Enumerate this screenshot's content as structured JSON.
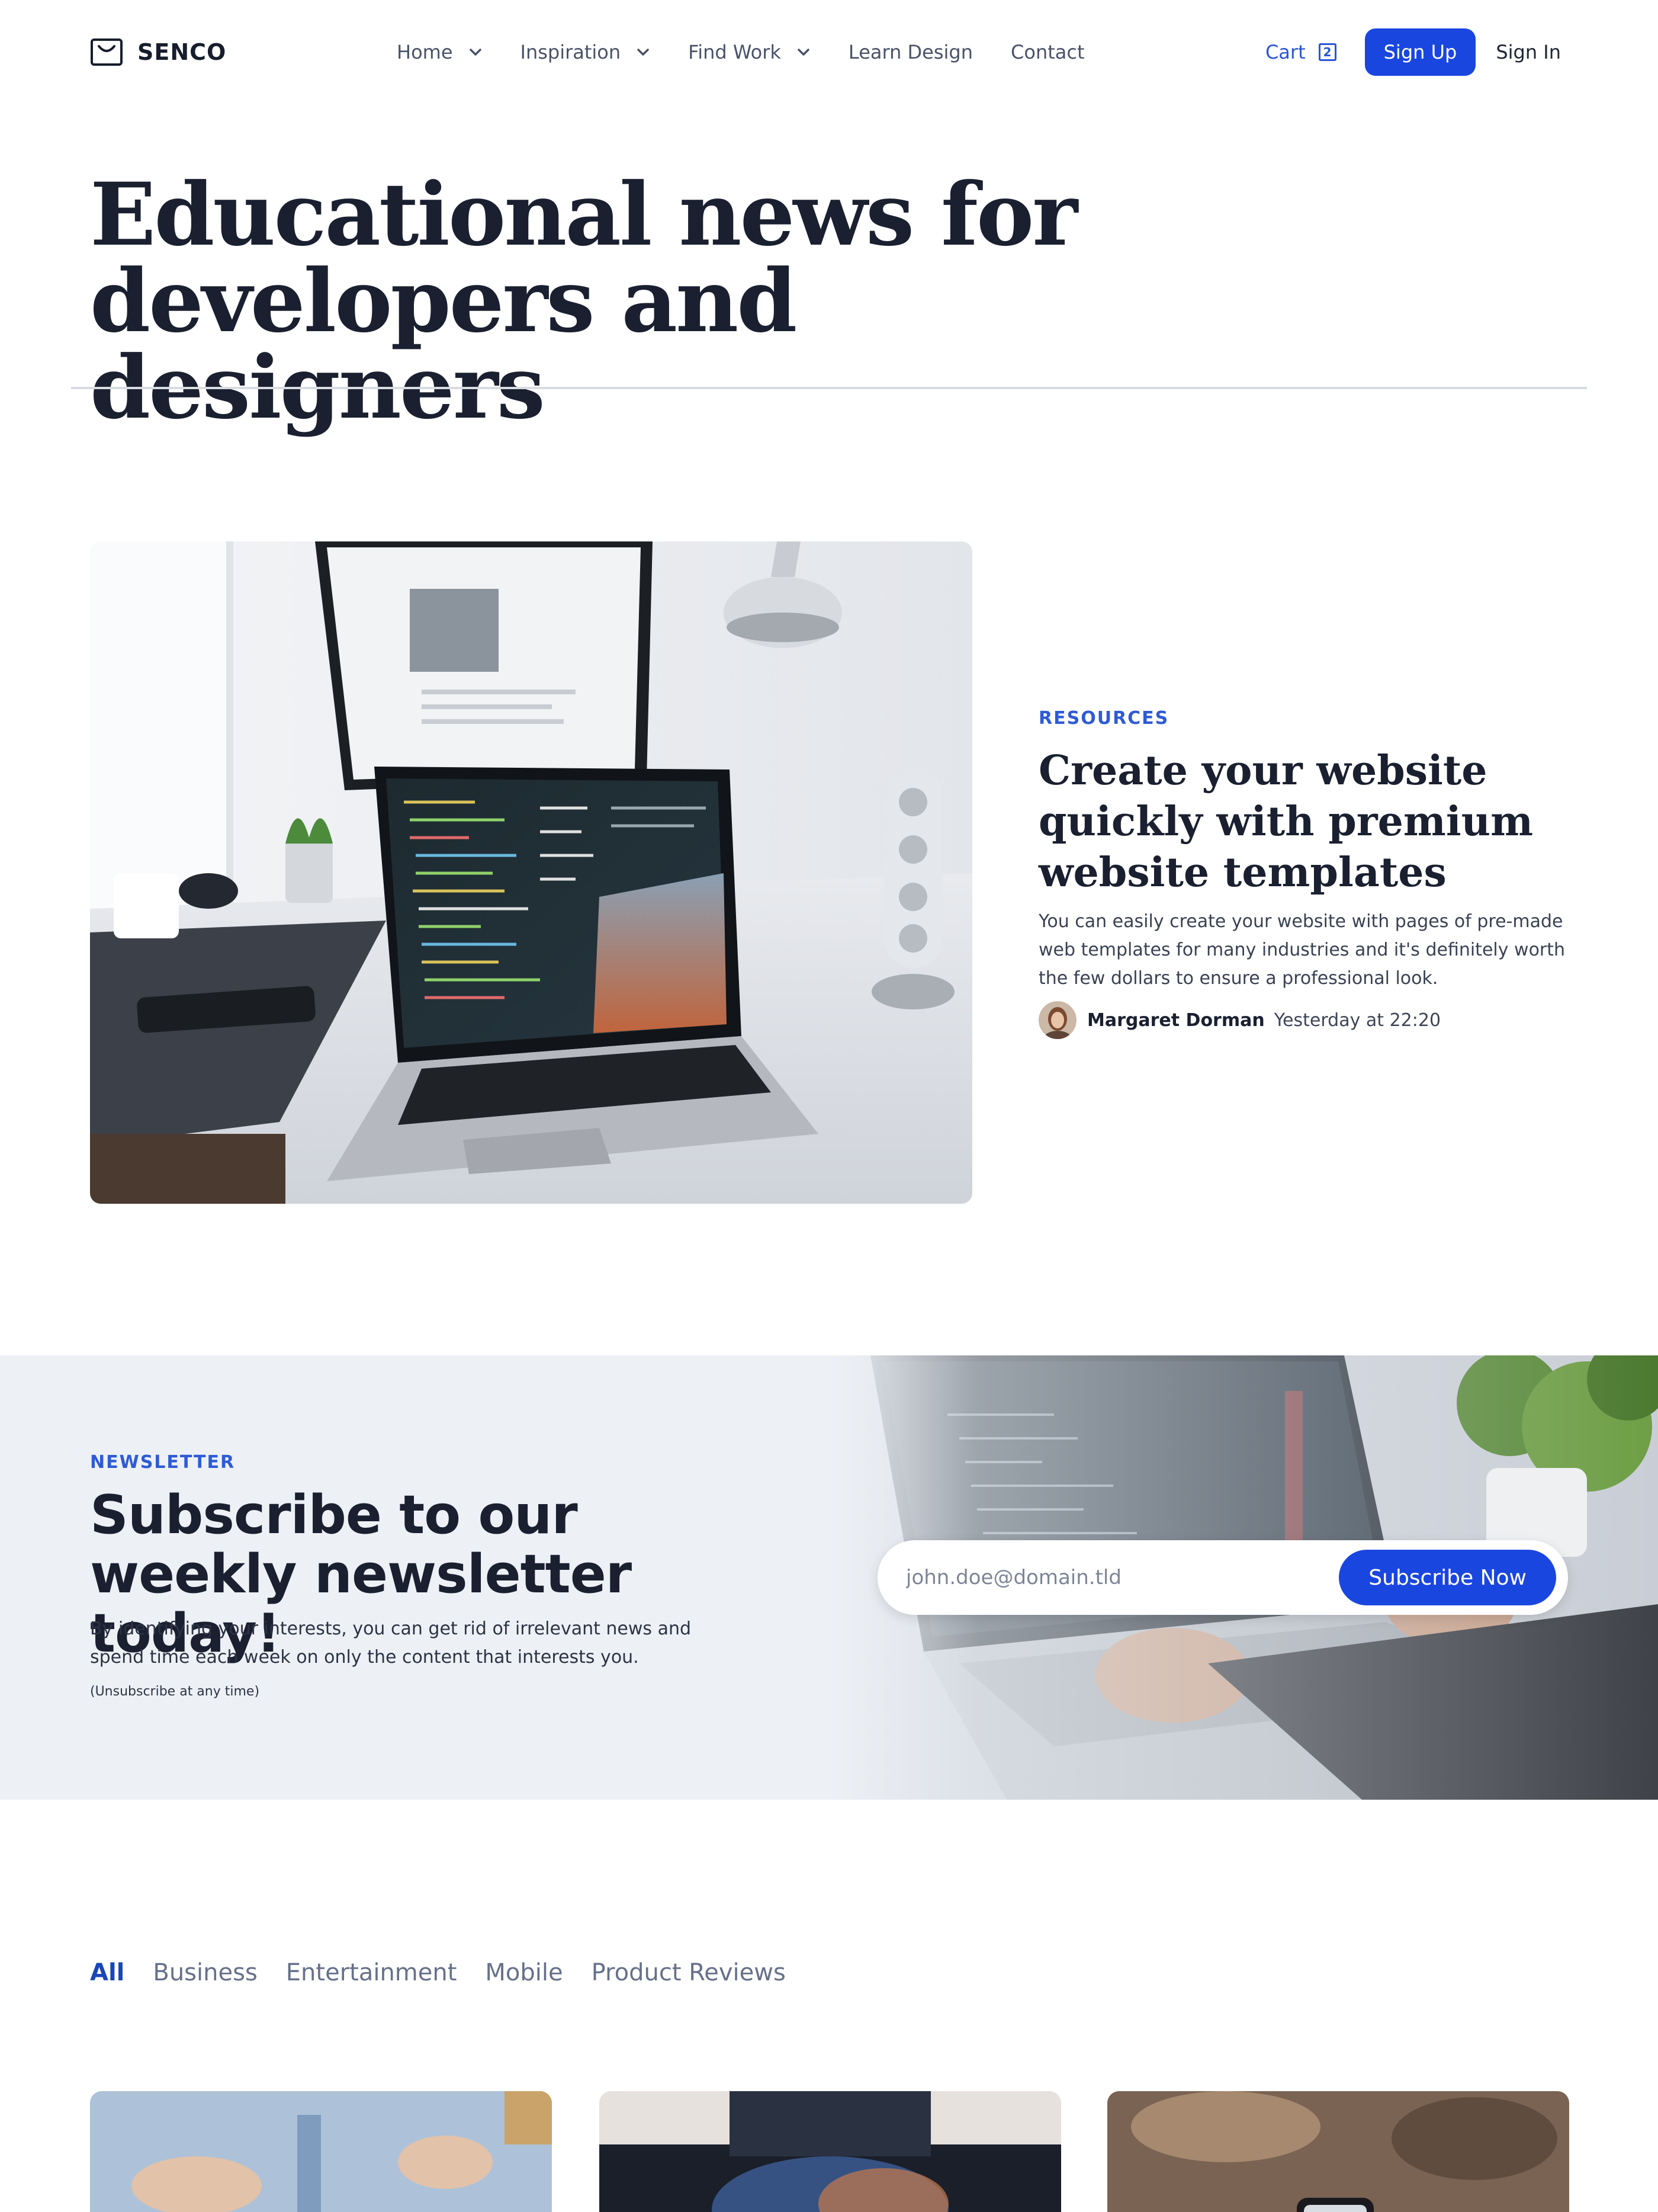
{
  "brand": {
    "name": "SENCO"
  },
  "nav": {
    "items": [
      {
        "label": "Home",
        "dropdown": true
      },
      {
        "label": "Inspiration",
        "dropdown": true
      },
      {
        "label": "Find Work",
        "dropdown": true
      },
      {
        "label": "Learn Design",
        "dropdown": false
      },
      {
        "label": "Contact",
        "dropdown": false
      }
    ],
    "cart_label": "Cart",
    "cart_count": "2",
    "signup_label": "Sign Up",
    "signin_label": "Sign In"
  },
  "hero": {
    "title_line1": "Educational news for",
    "title_line2": "developers and designers"
  },
  "featured": {
    "category": "RESOURCES",
    "title": "Create your website quickly with premium website templates",
    "description": "You can easily create your website with pages of pre-made web templates for many industries and it's definitely worth the few dollars to ensure a professional look.",
    "author": "Margaret Dorman",
    "time": "Yesterday at 22:20"
  },
  "newsletter": {
    "label": "NEWSLETTER",
    "title": "Subscribe to our weekly newsletter today!",
    "description": "By identifying your interests, you can get rid of irrelevant news and spend time each week on only the content that interests you.",
    "note": "(Unsubscribe at any time)",
    "email_placeholder": "john.doe@domain.tld",
    "button_label": "Subscribe Now"
  },
  "tabs": [
    {
      "label": "All",
      "active": true
    },
    {
      "label": "Business",
      "active": false
    },
    {
      "label": "Entertainment",
      "active": false
    },
    {
      "label": "Mobile",
      "active": false
    },
    {
      "label": "Product Reviews",
      "active": false
    }
  ],
  "colors": {
    "accent": "#1a46e0",
    "category": "#2e5bd6",
    "heading": "#1a2030",
    "newsletter_bg": "#edf1f6"
  },
  "icons": {
    "logo": "shopping-bag-icon",
    "chevron": "chevron-down-icon",
    "cart": "cart-count-badge"
  }
}
